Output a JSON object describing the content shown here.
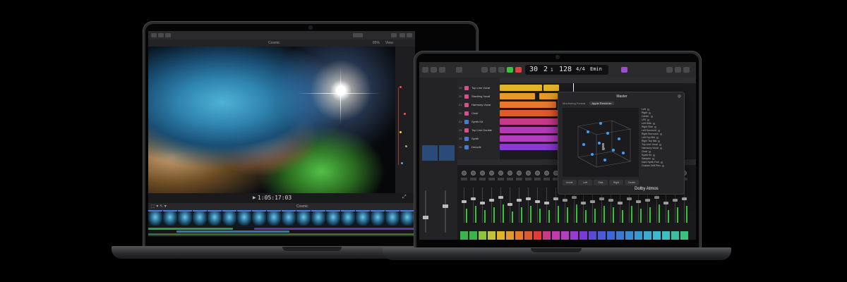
{
  "fcp": {
    "viewer_title": "Cosmic",
    "zoom": "85%",
    "view_label": "View",
    "timecode": "1:05:17:03",
    "timeline_label": "Cosmic"
  },
  "logic": {
    "lcd": {
      "bar": "30",
      "beat": "2",
      "sub": "1",
      "tempo": "128",
      "key": "Emin",
      "sig": "4/4"
    },
    "tracks": [
      {
        "num": "19",
        "name": "Top Line Vocal"
      },
      {
        "num": "20",
        "name": "Stacking Vocal"
      },
      {
        "num": "21",
        "name": "Harmony Vocal"
      },
      {
        "num": "22",
        "name": "Choir"
      },
      {
        "num": "23",
        "name": "Synth Kit"
      },
      {
        "num": "24",
        "name": "Top Line Double"
      },
      {
        "num": "25",
        "name": "Synth"
      },
      {
        "num": "26",
        "name": "Decode"
      }
    ],
    "atmos": {
      "title": "Master",
      "panning_label": "Monitoring Format",
      "panning_value": "Apple Renderer",
      "objects": [
        "Left",
        "Right",
        "Center",
        "LFE",
        "Left Side",
        "Right Side",
        "Left Surround",
        "Right Surround",
        "Left Top Mid",
        "Right Top Mid",
        "Top Line Vocal",
        "Harmony Vocal",
        "Choir",
        "Synth Kit",
        "Sampler",
        "Dark Synth Pad",
        "Custom Drill Perc"
      ],
      "tabs": [
        "Inside",
        "Left",
        "Side",
        "Right",
        "Center"
      ],
      "logo": "Dolby Atmos"
    }
  }
}
